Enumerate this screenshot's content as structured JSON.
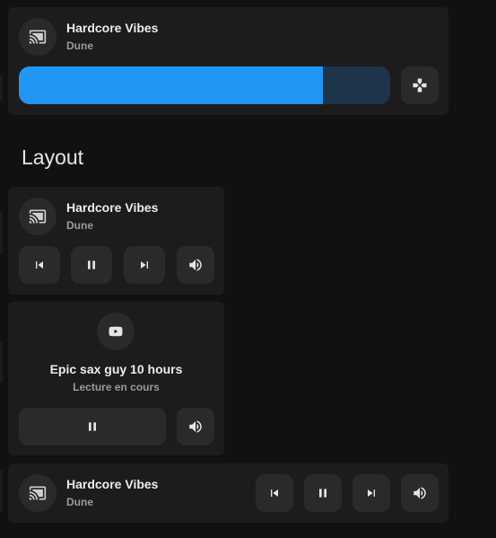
{
  "card1": {
    "title": "Hardcore Vibes",
    "subtitle": "Dune",
    "icon": "cast-icon",
    "volume_level": 0.82,
    "volume_fill_color": "#2196f3",
    "volume_track_color": "#203449",
    "action_icon": "gamepad-icon"
  },
  "heading": "Layout",
  "card2": {
    "title": "Hardcore Vibes",
    "subtitle": "Dune",
    "icon": "cast-icon",
    "controls": [
      "previous-icon",
      "pause-icon",
      "next-icon",
      "volume-icon"
    ]
  },
  "card3": {
    "title": "Epic sax guy 10 hours",
    "subtitle": "Lecture en cours",
    "icon": "youtube-icon",
    "controls": [
      "pause-icon",
      "volume-icon"
    ]
  },
  "card4": {
    "title": "Hardcore Vibes",
    "subtitle": "Dune",
    "icon": "cast-icon",
    "controls": [
      "previous-icon",
      "pause-icon",
      "next-icon",
      "volume-icon"
    ]
  },
  "colors": {
    "background": "#111111",
    "card": "#1c1c1c",
    "button": "#2a2a2a",
    "text": "#ececec",
    "secondary_text": "#9a9a9a"
  }
}
